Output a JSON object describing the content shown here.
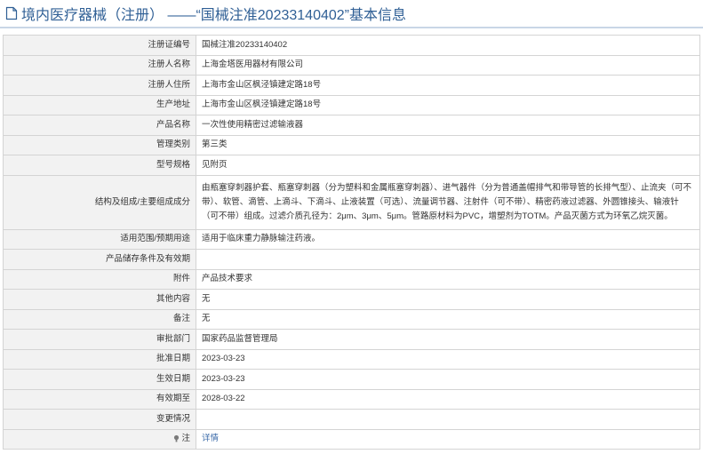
{
  "header": {
    "title": "境内医疗器械（注册） ——“国械注准20233140402”基本信息",
    "icon": "document-icon"
  },
  "rows": [
    {
      "label": "注册证编号",
      "value": "国械注准20233140402"
    },
    {
      "label": "注册人名称",
      "value": "上海金塔医用器材有限公司"
    },
    {
      "label": "注册人住所",
      "value": "上海市金山区枫泾镇建定路18号"
    },
    {
      "label": "生产地址",
      "value": "上海市金山区枫泾镇建定路18号"
    },
    {
      "label": "产品名称",
      "value": "一次性使用精密过滤输液器"
    },
    {
      "label": "管理类别",
      "value": "第三类"
    },
    {
      "label": "型号规格",
      "value": "见附页"
    },
    {
      "label": "结构及组成/主要组成成分",
      "value": "由瓶塞穿刺器护套、瓶塞穿刺器（分为塑料和金属瓶塞穿刺器）、进气器件（分为普通盖帽排气和带导管的长排气型）、止流夹（可不带）、软管、滴管、上滴斗、下滴斗、止液装置（可选）、流量调节器、注射件（可不带）、精密药液过滤器、外圆锥接头、输液针（可不带）组成。过滤介质孔径为：2μm、3μm、5μm。管路原材料为PVC，增塑剂为TOTM。产品灭菌方式为环氧乙烷灭菌。"
    },
    {
      "label": "适用范围/预期用途",
      "value": "适用于临床重力静脉输注药液。"
    },
    {
      "label": "产品储存条件及有效期",
      "value": ""
    },
    {
      "label": "附件",
      "value": "产品技术要求"
    },
    {
      "label": "其他内容",
      "value": "无"
    },
    {
      "label": "备注",
      "value": "无"
    },
    {
      "label": "审批部门",
      "value": "国家药品监督管理局"
    },
    {
      "label": "批准日期",
      "value": "2023-03-23"
    },
    {
      "label": "生效日期",
      "value": "2023-03-23"
    },
    {
      "label": "有效期至",
      "value": "2028-03-22"
    },
    {
      "label": "变更情况",
      "value": ""
    },
    {
      "label": "注",
      "value": "详情"
    }
  ],
  "colors": {
    "title": "#2f5f95",
    "label_bg": "#f2f2f2",
    "border": "#d4d4d4",
    "link": "#3a6aa8"
  }
}
